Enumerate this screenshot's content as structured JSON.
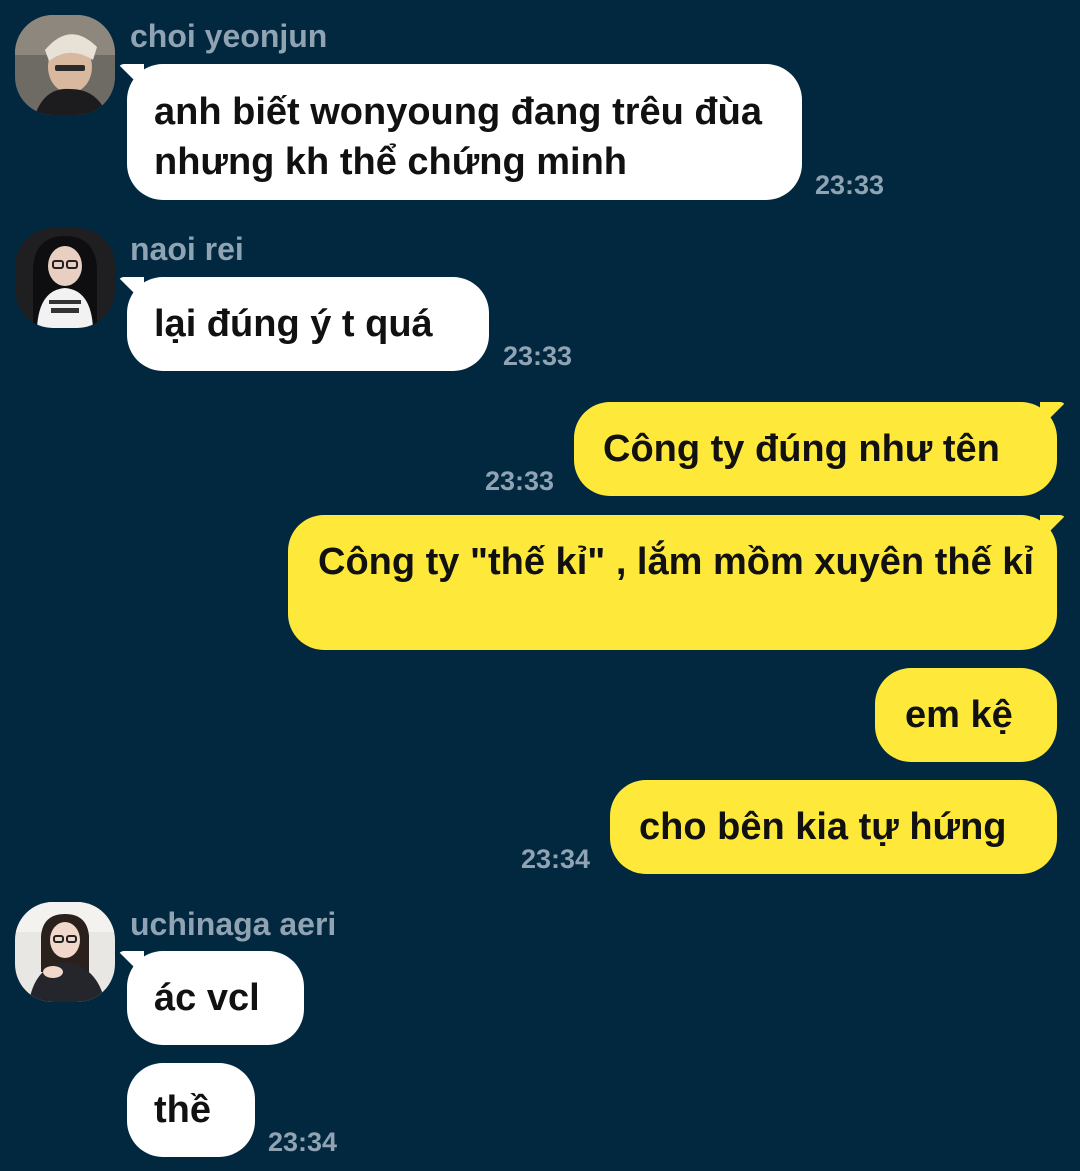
{
  "colors": {
    "background": "#022840",
    "incoming_bubble": "#ffffff",
    "outgoing_bubble": "#fee93a",
    "meta_text": "#8fa3b3",
    "message_text": "#111111"
  },
  "messages": [
    {
      "sender": "choi yeonjun",
      "avatar_icon": "profile-photo-avatar",
      "bubbles": [
        "anh biết wonyoung đang trêu đùa nhưng kh thể chứng minh"
      ],
      "time": "23:33"
    },
    {
      "sender": "naoi rei",
      "avatar_icon": "profile-photo-avatar",
      "bubbles": [
        "lại đúng ý t quá"
      ],
      "time": "23:33"
    },
    {
      "direction": "outgoing",
      "bubbles": [
        "Công ty đúng như tên",
        "Công ty \"thế kỉ\" , lắm mồm xuyên thế kỉ"
      ],
      "time": "23:33"
    },
    {
      "direction": "outgoing",
      "bubbles": [
        "em kệ",
        "cho bên kia tự hứng"
      ],
      "time": "23:34"
    },
    {
      "sender": "uchinaga aeri",
      "avatar_icon": "profile-photo-avatar",
      "bubbles": [
        "ác vcl",
        "thề"
      ],
      "time": "23:34"
    }
  ]
}
